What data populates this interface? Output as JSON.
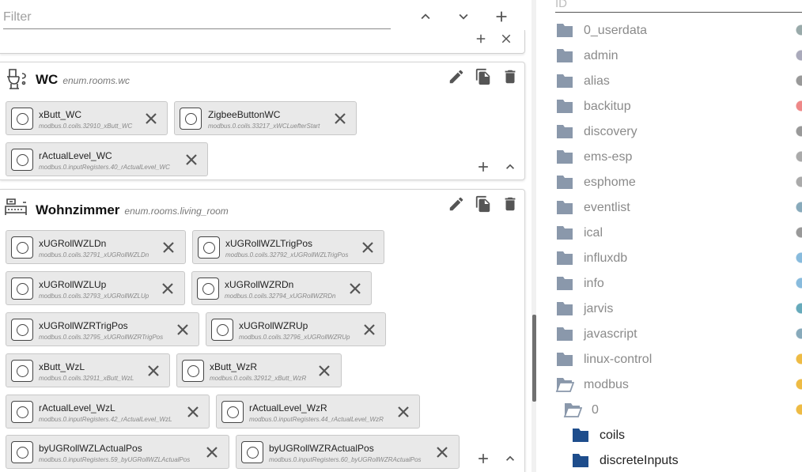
{
  "filter": {
    "placeholder": "Filter"
  },
  "toolbar": {
    "collapse_icon": "chevron-up-icon",
    "expand_icon": "chevron-down-icon",
    "add_icon": "plus-icon"
  },
  "rooms": [
    {
      "name": "WC",
      "enum": "enum.rooms.wc",
      "chips": [
        {
          "title": "xButt_WC",
          "sub": "modbus.0.coils.32910_xButt_WC"
        },
        {
          "title": "ZigbeeButtonWC",
          "sub": "modbus.0.coils.33217_xWCLuefterStart"
        },
        {
          "title": "rActualLevel_WC",
          "sub": "modbus.0.inputRegisters.40_rActualLevel_WC"
        }
      ]
    },
    {
      "name": "Wohnzimmer",
      "enum": "enum.rooms.living_room",
      "chips": [
        {
          "title": "xUGRollWZLDn",
          "sub": "modbus.0.coils.32791_xUGRollWZLDn"
        },
        {
          "title": "xUGRollWZLTrigPos",
          "sub": "modbus.0.coils.32792_xUGRollWZLTrigPos"
        },
        {
          "title": "xUGRollWZLUp",
          "sub": "modbus.0.coils.32793_xUGRollWZLUp"
        },
        {
          "title": "xUGRollWZRDn",
          "sub": "modbus.0.coils.32794_xUGRollWZRDn"
        },
        {
          "title": "xUGRollWZRTrigPos",
          "sub": "modbus.0.coils.32795_xUGRollWZRTrigPos"
        },
        {
          "title": "xUGRollWZRUp",
          "sub": "modbus.0.coils.32796_xUGRollWZRUp"
        },
        {
          "title": "xButt_WzL",
          "sub": "modbus.0.coils.32911_xButt_WzL"
        },
        {
          "title": "xButt_WzR",
          "sub": "modbus.0.coils.32912_xButt_WzR"
        },
        {
          "title": "rActualLevel_WzL",
          "sub": "modbus.0.inputRegisters.42_rActualLevel_WzL"
        },
        {
          "title": "rActualLevel_WzR",
          "sub": "modbus.0.inputRegisters.44_rActualLevel_WzR"
        },
        {
          "title": "byUGRollWZLActualPos",
          "sub": "modbus.0.inputRegisters.59_byUGRollWZLActualPos"
        },
        {
          "title": "byUGRollWZRActualPos",
          "sub": "modbus.0.inputRegisters.60_byUGRollWZRActualPos"
        }
      ]
    }
  ],
  "tree": {
    "header": "ID",
    "items": [
      {
        "label": "0_userdata"
      },
      {
        "label": "admin"
      },
      {
        "label": "alias"
      },
      {
        "label": "backitup"
      },
      {
        "label": "discovery"
      },
      {
        "label": "ems-esp"
      },
      {
        "label": "esphome"
      },
      {
        "label": "eventlist"
      },
      {
        "label": "ical"
      },
      {
        "label": "influxdb"
      },
      {
        "label": "info"
      },
      {
        "label": "jarvis"
      },
      {
        "label": "javascript"
      },
      {
        "label": "linux-control"
      },
      {
        "label": "modbus"
      },
      {
        "label": "0"
      },
      {
        "label": "coils"
      },
      {
        "label": "discreteInputs"
      }
    ]
  },
  "colors": {
    "folder_grey": "#8a98ab",
    "folder_dark": "#1e4d8c",
    "chip_bg": "#e9e9e9"
  }
}
